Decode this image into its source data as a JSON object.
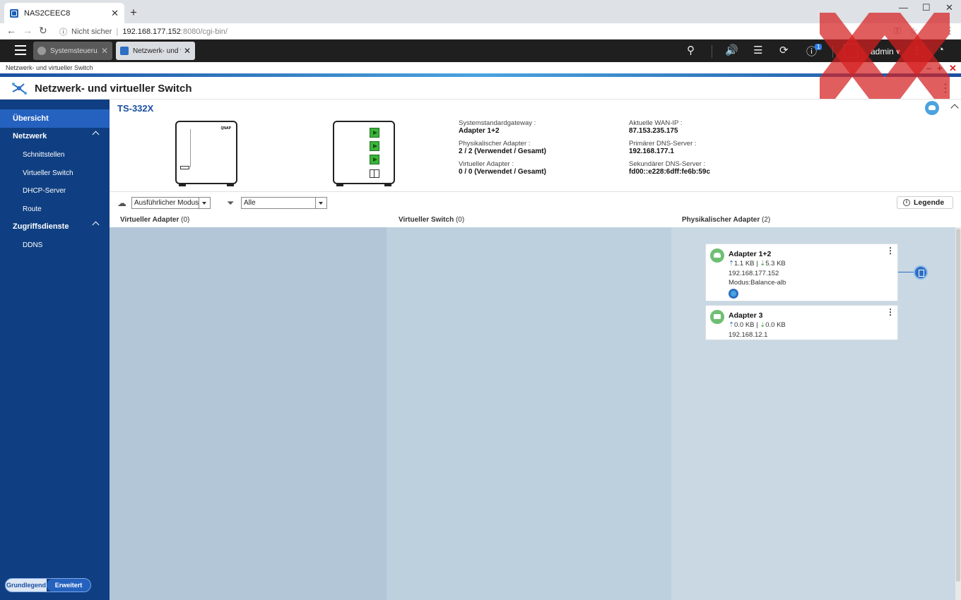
{
  "browser": {
    "tab_title": "NAS2CEEC8",
    "security_label": "Nicht sicher",
    "url_host": "192.168.177.152",
    "url_path": ":8080/cgi-bin/"
  },
  "qts": {
    "app_tabs": [
      {
        "label": "Systemsteueru..."
      },
      {
        "label": "Netzwerk- und v..."
      }
    ],
    "notification_count": "1",
    "username": "admin"
  },
  "window": {
    "strip_title": "Netzwerk- und virtueller Switch",
    "app_title": "Netzwerk- und virtueller Switch"
  },
  "sidebar": {
    "overview": "Übersicht",
    "network": "Netzwerk",
    "interfaces": "Schnittstellen",
    "virtual_switch": "Virtueller Switch",
    "dhcp": "DHCP-Server",
    "route": "Route",
    "access_services": "Zugriffsdienste",
    "ddns": "DDNS",
    "mode_basic": "Grundlegend",
    "mode_advanced": "Erweitert"
  },
  "device": {
    "name": "TS-332X",
    "logo_text": "QNAP",
    "gateway_label": "Systemstandardgateway :",
    "gateway_value": "Adapter 1+2",
    "phys_label": "Physikalischer Adapter :",
    "phys_value": "2 / 2 (Verwendet / Gesamt)",
    "virt_label": "Virtueller Adapter :",
    "virt_value": "0 / 0 (Verwendet / Gesamt)",
    "wan_label": "Aktuelle WAN-IP :",
    "wan_value": "87.153.235.175",
    "dns1_label": "Primärer DNS-Server :",
    "dns1_value": "192.168.177.1",
    "dns2_label": "Sekundärer DNS-Server :",
    "dns2_value": "fd00::e228:6dff:fe6b:59c"
  },
  "toolbar": {
    "mode_select": "Ausführlicher Modus",
    "filter_select": "Alle",
    "legend": "Legende"
  },
  "columns": {
    "virtual_adapter": "Virtueller Adapter",
    "virtual_adapter_count": "(0)",
    "virtual_switch": "Virtueller Switch",
    "virtual_switch_count": "(0)",
    "physical_adapter": "Physikalischer Adapter",
    "physical_adapter_count": "(2)"
  },
  "adapters": [
    {
      "name": "Adapter 1+2",
      "upload": "1.1 KB",
      "download": "5.3 KB",
      "ip": "192.168.177.152",
      "mode": "Modus:Balance-alb"
    },
    {
      "name": "Adapter 3",
      "upload": "0.0 KB",
      "download": "0.0 KB",
      "ip": "192.168.12.1"
    }
  ],
  "colors": {
    "sidebar_bg": "#0f3f82",
    "sidebar_active": "#2562bf",
    "accent": "#1a4fa0",
    "watermark": "#d62020"
  }
}
